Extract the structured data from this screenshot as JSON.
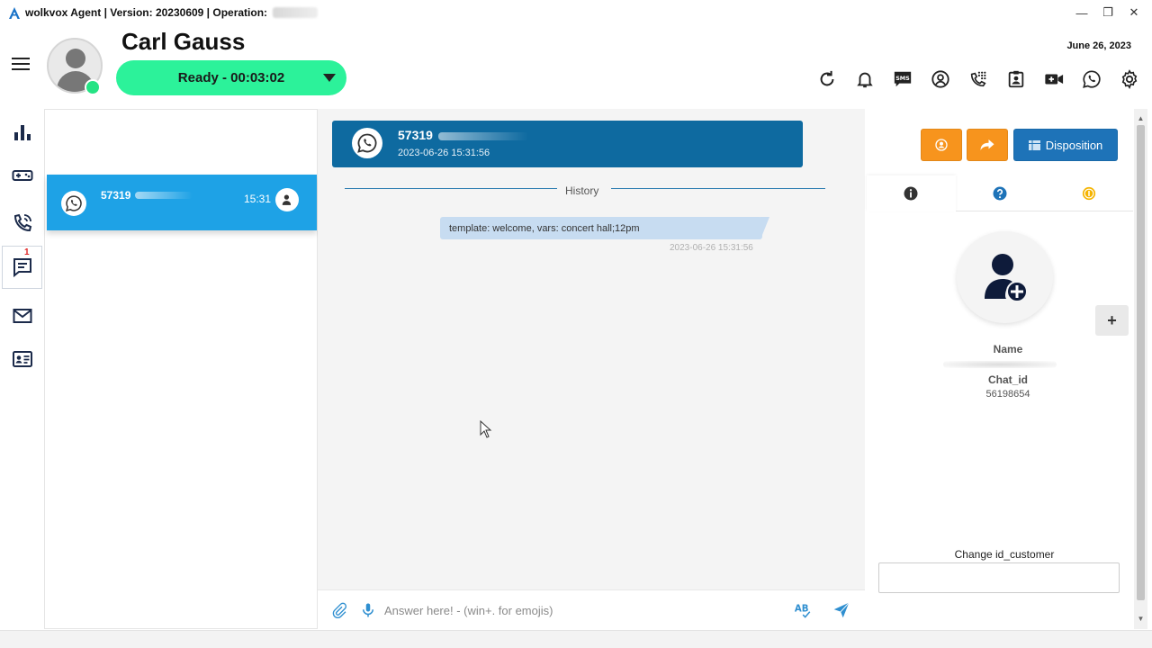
{
  "window": {
    "title": "wolkvox Agent | Version: 20230609  | Operation:",
    "controls": {
      "minimize": "—",
      "restore": "❐",
      "close": "✕"
    }
  },
  "header": {
    "agent_name": "Carl Gauss",
    "status": "Ready  -  00:03:02",
    "date": "June 26, 2023",
    "status_color": "#2cf29a",
    "toolbar_icons": [
      "refresh-icon",
      "bell-icon",
      "sms-icon",
      "user-circle-icon",
      "dialpad-icon",
      "contact-card-icon",
      "video-icon",
      "whatsapp-icon",
      "gear-icon"
    ]
  },
  "rail": {
    "icons": [
      "stats-icon",
      "gamepad-icon",
      "phone-icon",
      "chat-icon",
      "mail-icon",
      "id-card-icon"
    ],
    "chat_badge": "1"
  },
  "chat_list": {
    "items": [
      {
        "number": "57319",
        "time": "15:31",
        "channel": "whatsapp"
      }
    ]
  },
  "conversation": {
    "number": "57319",
    "timestamp": "2023-06-26 15:31:56",
    "history_label": "History",
    "messages": [
      {
        "text": "template: welcome, vars: concert hall;12pm",
        "time": "2023-06-26 15:31:56"
      }
    ],
    "composer_placeholder": "Answer here! - (win+. for emojis)",
    "accent": "#0e6aa0"
  },
  "right_panel": {
    "disposition_label": "Disposition",
    "tabs": [
      "info-icon",
      "help-icon",
      "coin-icon"
    ],
    "name_label": "Name",
    "chat_id_label": "Chat_id",
    "chat_id_value": "56198654",
    "add_label": "+",
    "change_label": "Change id_customer",
    "button_color": "#f7941d"
  }
}
